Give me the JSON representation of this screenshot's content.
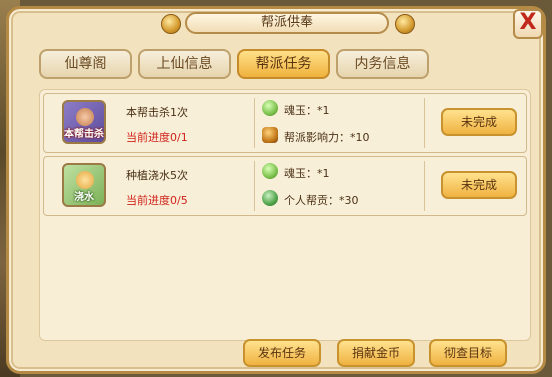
{
  "window": {
    "title": "帮派供奉",
    "close_label": "X"
  },
  "tabs": [
    {
      "label": "仙尊阁",
      "active": false
    },
    {
      "label": "上仙信息",
      "active": false
    },
    {
      "label": "帮派任务",
      "active": true
    },
    {
      "label": "内务信息",
      "active": false
    }
  ],
  "tasks": [
    {
      "icon": "kill-icon",
      "icon_tag": "本帮击杀",
      "name": "本帮击杀1次",
      "progress": "当前进度0/1",
      "rewards": [
        {
          "icon": "jade-soul-icon",
          "label": "魂玉：*1"
        },
        {
          "icon": "influence-seal-icon",
          "label": "帮派影响力：*10"
        }
      ],
      "status": "未完成"
    },
    {
      "icon": "watering-icon",
      "icon_tag": "浇水",
      "name": "种植浇水5次",
      "progress": "当前进度0/5",
      "rewards": [
        {
          "icon": "jade-soul-icon",
          "label": "魂玉：*1"
        },
        {
          "icon": "contribution-coin-icon",
          "label": "个人帮贡：*30"
        }
      ],
      "status": "未完成"
    }
  ],
  "footer": {
    "publish_label": "发布任务",
    "donate_label": "捐献金币",
    "goal_label": "彻查目标"
  },
  "colors": {
    "accent": "#f0b23d",
    "progress_text": "#d0221a",
    "panel_bg": "#f2e3be"
  }
}
